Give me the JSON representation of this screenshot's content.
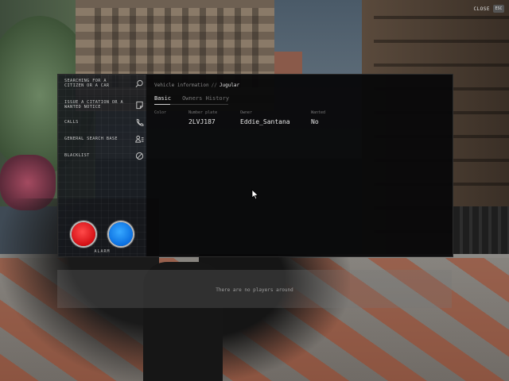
{
  "top_bar": {
    "close_label": "CLOSE",
    "close_key": "ESC"
  },
  "sidebar": {
    "items": [
      {
        "label": "SEARCHING FOR A CITIZEN OR A CAR",
        "icon": "search-icon"
      },
      {
        "label": "ISSUE A CITATION OR A WANTED NOTICE",
        "icon": "note-icon"
      },
      {
        "label": "CALLS",
        "icon": "phone-icon"
      },
      {
        "label": "GENERAL SEARCH BASE",
        "icon": "user-list-icon"
      },
      {
        "label": "BLACKLIST",
        "icon": "blocked-icon"
      }
    ],
    "alarm_label": "ALARM",
    "alarm_colors": {
      "red": "#e8141a",
      "blue": "#1a8cff"
    }
  },
  "content": {
    "breadcrumb": {
      "section": "Vehicle information",
      "separator": "//",
      "model": "Jugular"
    },
    "tabs": [
      {
        "label": "Basic",
        "active": true
      },
      {
        "label": "Owners History",
        "active": false
      }
    ],
    "fields": [
      {
        "label": "Color",
        "value": ""
      },
      {
        "label": "Number plate",
        "value": "2LVJ187"
      },
      {
        "label": "Owner",
        "value": "Eddie_Santana"
      },
      {
        "label": "Wanted",
        "value": "No"
      }
    ]
  },
  "notification": {
    "text": "There are no players around"
  }
}
